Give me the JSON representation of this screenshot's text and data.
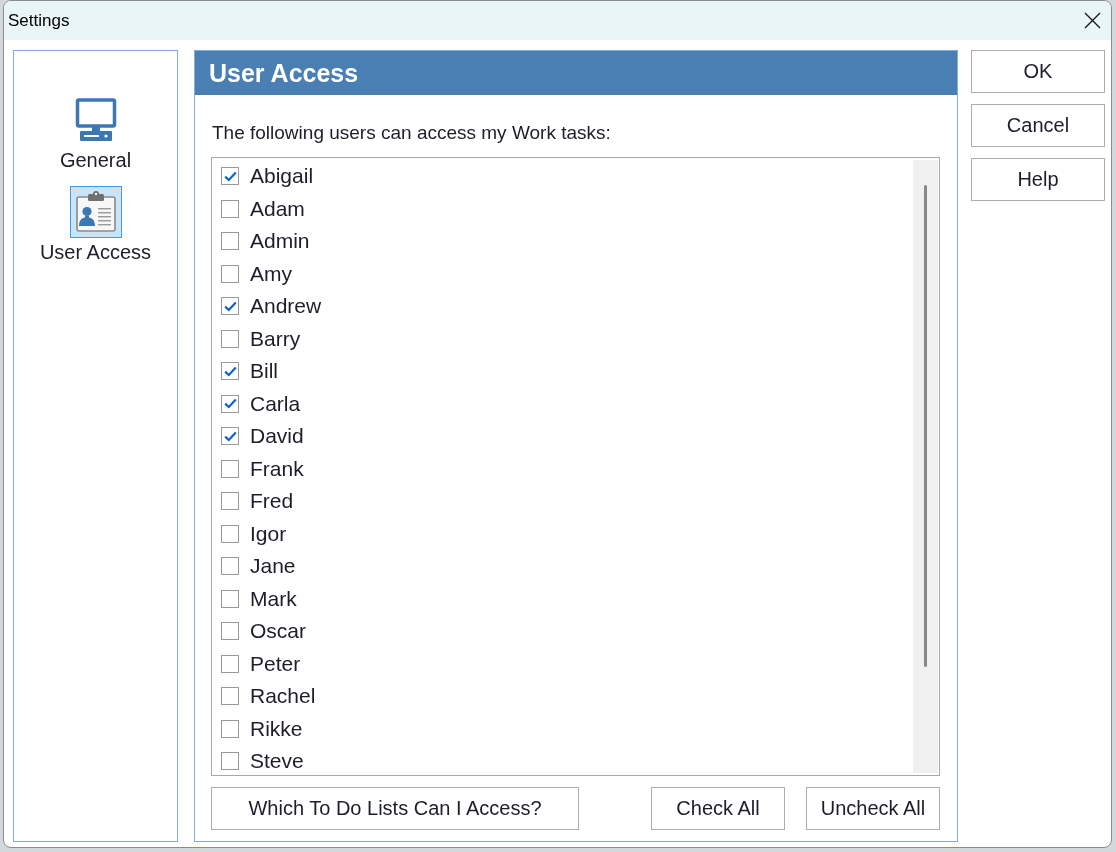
{
  "window": {
    "title": "Settings"
  },
  "sidebar": {
    "items": [
      {
        "label": "General",
        "kind": "monitor",
        "selected": false
      },
      {
        "label": "User Access",
        "kind": "card",
        "selected": true
      }
    ]
  },
  "panel": {
    "title": "User Access",
    "instruction": "The following users can access my Work tasks:",
    "users": [
      {
        "name": "Abigail",
        "checked": true
      },
      {
        "name": "Adam",
        "checked": false
      },
      {
        "name": "Admin",
        "checked": false
      },
      {
        "name": "Amy",
        "checked": false
      },
      {
        "name": "Andrew",
        "checked": true
      },
      {
        "name": "Barry",
        "checked": false
      },
      {
        "name": "Bill",
        "checked": true
      },
      {
        "name": "Carla",
        "checked": true
      },
      {
        "name": "David",
        "checked": true
      },
      {
        "name": "Frank",
        "checked": false
      },
      {
        "name": "Fred",
        "checked": false
      },
      {
        "name": "Igor",
        "checked": false
      },
      {
        "name": "Jane",
        "checked": false
      },
      {
        "name": "Mark",
        "checked": false
      },
      {
        "name": "Oscar",
        "checked": false
      },
      {
        "name": "Peter",
        "checked": false
      },
      {
        "name": "Rachel",
        "checked": false
      },
      {
        "name": "Rikke",
        "checked": false
      },
      {
        "name": "Steve",
        "checked": false
      }
    ],
    "buttons": [
      "Which To Do Lists Can I Access?",
      "Check All",
      "Uncheck All"
    ]
  },
  "dialog_buttons": [
    "OK",
    "Cancel",
    "Help"
  ]
}
